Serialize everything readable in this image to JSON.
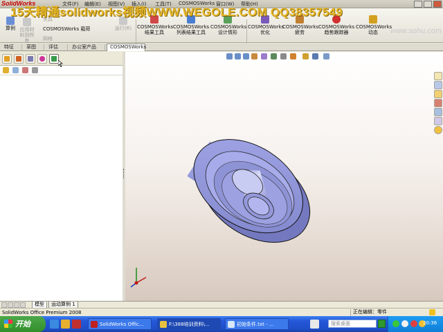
{
  "window": {
    "app_logo": "SolidWorks",
    "watermark": "15天精通solidworks视频WWW.WEGOLE.COM QQ38357549",
    "menus": [
      "文件(F)",
      "编辑(E)",
      "视图(V)",
      "插入(I)",
      "工具(T)",
      "COSMOSWorks",
      "窗口(W)",
      "帮助(H)"
    ]
  },
  "command_manager": {
    "items": [
      {
        "label": "算例"
      },
      {
        "label": "应用材料到所有"
      },
      {
        "label": "夹具"
      },
      {
        "label": "COSMOSWorks 载荷"
      },
      {
        "label": "网格"
      },
      {
        "label": "运行(R)"
      },
      {
        "label": "COSMOSWorks 结果工具"
      },
      {
        "label": "COSMOSWorks 列表结果工具"
      },
      {
        "label": "COSMOSWorks 设计情形"
      },
      {
        "label": "COSMOSWorks 优化"
      },
      {
        "label": "COSMOSWorks 疲劳"
      },
      {
        "label": "COSMOSWorks 趋势跟踪器"
      },
      {
        "label": "COSMOSWorks 动态"
      }
    ],
    "site_logo": "www.sohu.com"
  },
  "tabs": [
    {
      "label": "特征"
    },
    {
      "label": "草图"
    },
    {
      "label": "评估"
    },
    {
      "label": "办公室产品"
    },
    {
      "label": "COSMOSWorks",
      "active": true
    }
  ],
  "bottom_tabs": [
    {
      "label": "模型",
      "active": true
    },
    {
      "label": "运动算例 1"
    }
  ],
  "status": {
    "left": "SolidWorks Office Premium 2008",
    "right": "正在编辑：零件"
  },
  "taskbar": {
    "start_label": "开始",
    "tasks": [
      {
        "label": "SolidWorks Offic..."
      },
      {
        "label": "F:\\388培训资料\\..."
      },
      {
        "label": "初始条件.txt - ..."
      }
    ],
    "search_placeholder": "搜索桌面",
    "clock": "20:36"
  },
  "colors": {
    "accent_red": "#c20000",
    "watermark": "#e7b318",
    "taskbar_blue": "#2457d8",
    "start_green": "#308f2b",
    "model_face": "#9aa0e0"
  }
}
